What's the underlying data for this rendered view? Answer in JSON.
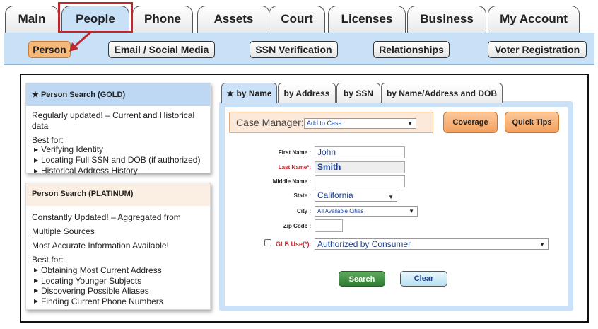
{
  "main_tabs": [
    {
      "label": "Main"
    },
    {
      "label": "People"
    },
    {
      "label": "Phone"
    },
    {
      "label": "Assets"
    },
    {
      "label": "Court"
    },
    {
      "label": "Licenses"
    },
    {
      "label": "Business"
    },
    {
      "label": "My Account"
    }
  ],
  "sub_tabs": [
    {
      "label": "Person"
    },
    {
      "label": "Email / Social Media"
    },
    {
      "label": "SSN Verification"
    },
    {
      "label": "Relationships"
    },
    {
      "label": "Voter Registration"
    }
  ],
  "gold_card": {
    "star": "★",
    "title": "Person Search (GOLD)",
    "desc": "Regularly updated! – Current and Historical data",
    "best_for": "Best for:",
    "bullets": [
      "Verifying Identity",
      "Locating Full SSN and DOB (if authorized)",
      "Historical Address History"
    ]
  },
  "platinum_card": {
    "title": "Person Search (PLATINUM)",
    "desc": "Constantly Updated! – Aggregated from Multiple Sources",
    "desc2": "Most Accurate Information Available!",
    "best_for": "Best for:",
    "bullets": [
      "Obtaining Most Current Address",
      "Locating Younger Subjects",
      "Discovering Possible Aliases",
      "Finding Current Phone Numbers"
    ]
  },
  "search_tabs": [
    {
      "label": "by Name",
      "star": "★"
    },
    {
      "label": "by Address"
    },
    {
      "label": "by SSN"
    },
    {
      "label": "by Name/Address and DOB"
    }
  ],
  "case_manager": {
    "label": "Case Manager:",
    "value": "Add to Case"
  },
  "buttons": {
    "coverage": "Coverage",
    "quick_tips": "Quick Tips",
    "search": "Search",
    "clear": "Clear"
  },
  "form": {
    "first_name": {
      "label": "First Name :",
      "value": "John"
    },
    "last_name": {
      "label": "Last Name*:",
      "value": "Smith"
    },
    "middle_name": {
      "label": "Middle Name :",
      "value": ""
    },
    "state": {
      "label": "State :",
      "value": "California"
    },
    "city": {
      "label": "City :",
      "value": "All Available Cities"
    },
    "zip": {
      "label": "Zip Code :",
      "value": ""
    },
    "glb": {
      "label": "GLB Use(*):",
      "value": "Authorized by Consumer"
    }
  },
  "colors": {
    "accent_blue": "#c9e1f6",
    "highlight_red": "#c0272d",
    "orange": "#f2a15f",
    "green": "#2f7d32"
  }
}
